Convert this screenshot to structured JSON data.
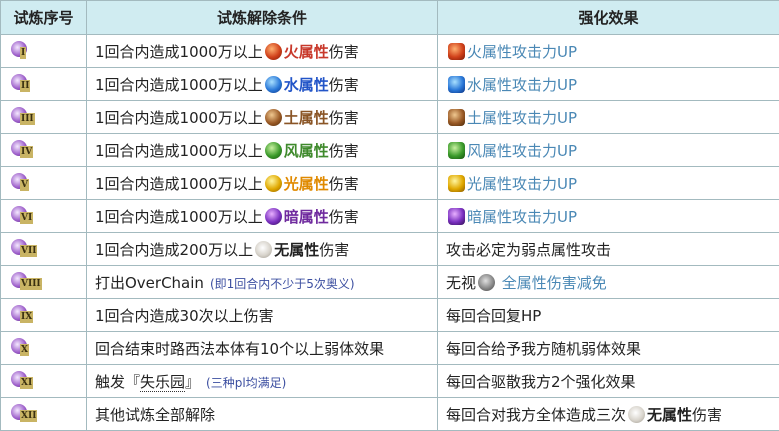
{
  "headers": [
    "试炼序号",
    "试炼解除条件",
    "强化效果"
  ],
  "colors": {
    "fire": "#c8392b",
    "water": "#2355c8",
    "earth": "#8a5526",
    "wind": "#3f8a2c",
    "light": "#e08a00",
    "dark": "#6f2a9e",
    "none": "#222222"
  },
  "rows": [
    {
      "rank": "I",
      "pre": "1回合内造成1000万以上",
      "elem": "火属性",
      "post": "伤害",
      "orb": "fire-orb-icon",
      "effect": "火属性攻击力UP"
    },
    {
      "rank": "II",
      "pre": "1回合内造成1000万以上",
      "elem": "水属性",
      "post": "伤害",
      "orb": "water-orb-icon",
      "effect": "水属性攻击力UP"
    },
    {
      "rank": "III",
      "pre": "1回合内造成1000万以上",
      "elem": "土属性",
      "post": "伤害",
      "orb": "earth-orb-icon",
      "effect": "土属性攻击力UP"
    },
    {
      "rank": "IV",
      "pre": "1回合内造成1000万以上",
      "elem": "风属性",
      "post": "伤害",
      "orb": "wind-orb-icon",
      "effect": "风属性攻击力UP"
    },
    {
      "rank": "V",
      "pre": "1回合内造成1000万以上",
      "elem": "光属性",
      "post": "伤害",
      "orb": "light-orb-icon",
      "effect": "光属性攻击力UP"
    },
    {
      "rank": "VI",
      "pre": "1回合内造成1000万以上",
      "elem": "暗属性",
      "post": "伤害",
      "orb": "dark-orb-icon",
      "effect": "暗属性攻击力UP"
    },
    {
      "rank": "VII",
      "pre": "1回合内造成200万以上",
      "elem": "无属性",
      "post": "伤害",
      "effect": "攻击必定为弱点属性攻击"
    },
    {
      "rank": "VIII",
      "pre": "打出OverChain",
      "note": "(即1回合内不少于5次奥义)",
      "effect_pre": "无视",
      "effect": "全属性伤害减免"
    },
    {
      "rank": "IX",
      "pre": "1回合内造成30次以上伤害",
      "effect": "每回合回复HP"
    },
    {
      "rank": "X",
      "pre": "回合结束时路西法本体有10个以上弱体效果",
      "effect": "每回合给予我方随机弱体效果"
    },
    {
      "rank": "XI",
      "pre": "触发『",
      "link": "失乐园",
      "post": "』",
      "note": "(三种pl均满足)",
      "effect": "每回合驱散我方2个强化效果"
    },
    {
      "rank": "XII",
      "pre": "其他试炼全部解除",
      "effect": "每回合对我方全体造成三次",
      "effect_elem": "无属性",
      "effect_post": "伤害"
    }
  ]
}
